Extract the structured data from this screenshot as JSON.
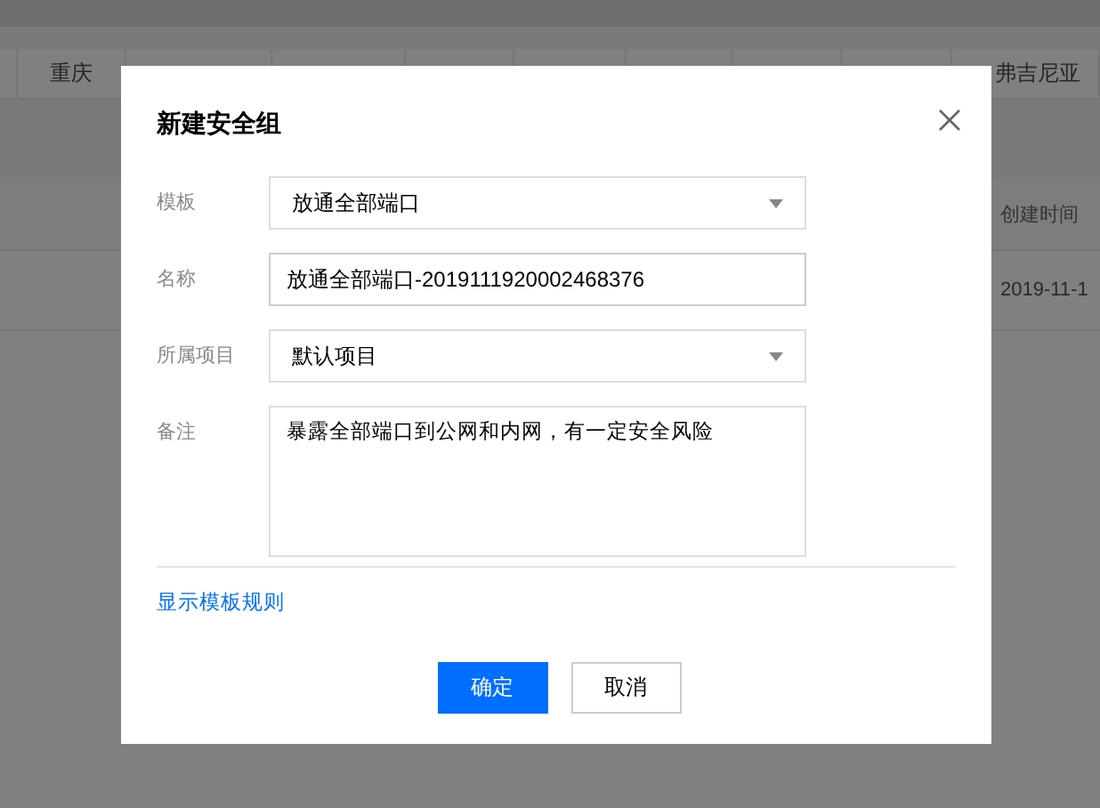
{
  "background": {
    "region_tabs": [
      {
        "label": "重庆"
      },
      {
        "label": "弗吉尼亚"
      }
    ],
    "table": {
      "columns": [
        "创建时间"
      ],
      "rows": [
        [
          "2019-11-1"
        ]
      ]
    }
  },
  "dialog": {
    "title": "新建安全组",
    "fields": [
      {
        "kind": "select",
        "label": "模板",
        "value": "放通全部端口"
      },
      {
        "kind": "input",
        "label": "名称",
        "value": "放通全部端口-2019111920002468376"
      },
      {
        "kind": "select",
        "label": "所属项目",
        "value": "默认项目"
      },
      {
        "kind": "textarea",
        "label": "备注",
        "value": "暴露全部端口到公网和内网，有一定安全风险"
      }
    ],
    "link": "显示模板规则",
    "buttons": [
      {
        "kind": "primary",
        "label": "确定"
      },
      {
        "kind": "secondary",
        "label": "取消"
      }
    ]
  }
}
